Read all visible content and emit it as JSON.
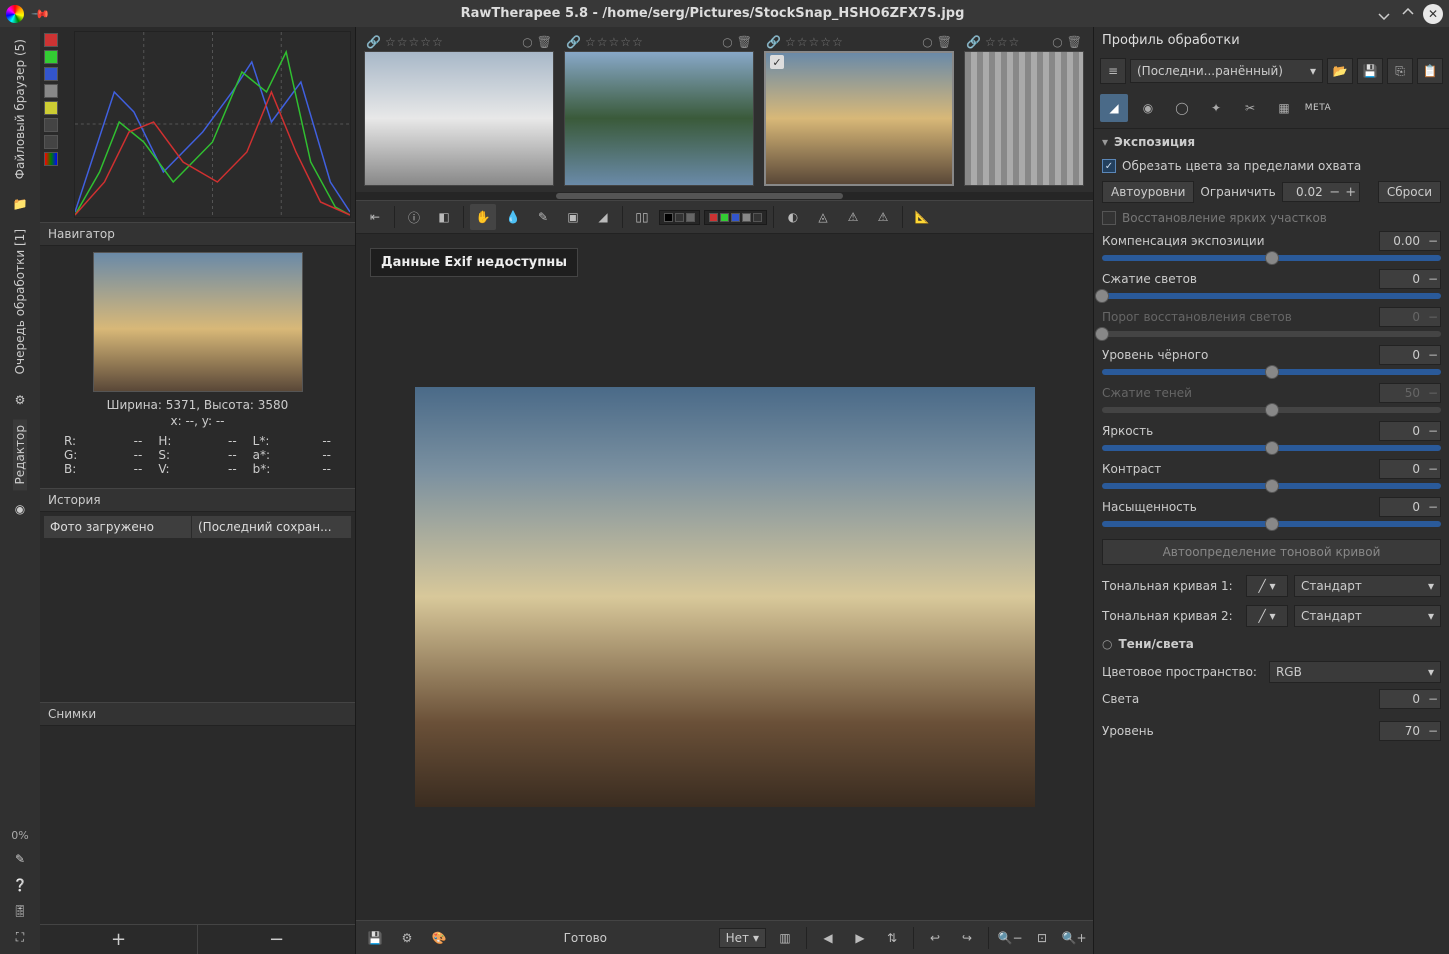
{
  "title": "RawTherapee 5.8 - /home/serg/Pictures/StockSnap_HSHO6ZFX7S.jpg",
  "leftTabs": {
    "browser": "Файловый браузер (5)",
    "queue": "Очередь обработки [1]",
    "editor": "Редактор"
  },
  "progress": "0%",
  "navigator": {
    "header": "Навигатор",
    "dims": "Ширина: 5371, Высота: 3580",
    "xy": "x: --, y: --",
    "rows": [
      {
        "a": "R:",
        "av": "--",
        "b": "H:",
        "bv": "--",
        "c": "L*:",
        "cv": "--"
      },
      {
        "a": "G:",
        "av": "--",
        "b": "S:",
        "bv": "--",
        "c": "a*:",
        "cv": "--"
      },
      {
        "a": "B:",
        "av": "--",
        "b": "V:",
        "bv": "--",
        "c": "b*:",
        "cv": "--"
      }
    ]
  },
  "history": {
    "header": "История",
    "row": {
      "a": "Фото загружено",
      "b": "(Последний сохран..."
    }
  },
  "snapshots": {
    "header": "Снимки"
  },
  "exif": "Данные Exif недоступны",
  "status": {
    "ready": "Готово",
    "gamut": "Нет"
  },
  "right": {
    "profile": {
      "header": "Профиль обработки",
      "select": "(Последни...ранённый)"
    },
    "exposure": {
      "header": "Экспозиция",
      "clip": "Обрезать цвета за пределами охвата",
      "auto": "Автоуровни",
      "limit": "Ограничить",
      "limit_val": "0.02",
      "reset": "Сброси",
      "recover": "Восстановление ярких участков",
      "sliders": [
        {
          "label": "Компенсация экспозиции",
          "val": "0.00",
          "pos": 50,
          "dis": false
        },
        {
          "label": "Сжатие светов",
          "val": "0",
          "pos": 0,
          "dis": false
        },
        {
          "label": "Порог восстановления светов",
          "val": "0",
          "pos": 0,
          "dis": true
        },
        {
          "label": "Уровень чёрного",
          "val": "0",
          "pos": 50,
          "dis": false
        },
        {
          "label": "Сжатие теней",
          "val": "50",
          "pos": 50,
          "dis": true
        },
        {
          "label": "Яркость",
          "val": "0",
          "pos": 50,
          "dis": false
        },
        {
          "label": "Контраст",
          "val": "0",
          "pos": 50,
          "dis": false
        },
        {
          "label": "Насыщенность",
          "val": "0",
          "pos": 50,
          "dis": false
        }
      ],
      "autotone": "Автоопределение тоновой кривой",
      "curve1_label": "Тональная кривая 1:",
      "curve2_label": "Тональная кривая 2:",
      "curve_mode": "Стандарт"
    },
    "shadows": {
      "header": "Тени/света",
      "colorspace_label": "Цветовое пространство:",
      "colorspace": "RGB",
      "highlights": {
        "label": "Света",
        "val": "0"
      },
      "level": {
        "label": "Уровень",
        "val": "70"
      }
    }
  },
  "meta_label": "META"
}
